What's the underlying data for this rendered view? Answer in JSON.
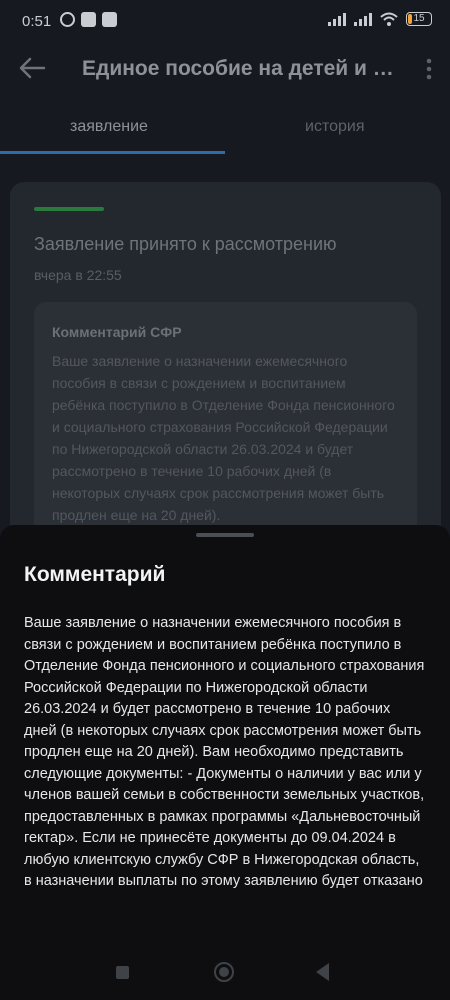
{
  "status_bar": {
    "time": "0:51",
    "battery": "15",
    "battery_color": "#f3a33a"
  },
  "app_bar": {
    "title": "Единое пособие на детей и беременным",
    "back_icon": "arrow-left-icon",
    "more_icon": "more-vertical-icon"
  },
  "tabs": [
    {
      "label": "заявление",
      "active": true
    },
    {
      "label": "история",
      "active": false
    }
  ],
  "card": {
    "status_title": "Заявление принято к рассмотрению",
    "date": "вчера в 22:55",
    "accent_color": "#2b7a3d",
    "comment_header": "Комментарий СФР",
    "comment_preview": "Ваше заявление о назначении ежемесячного пособия в связи с рождением и воспитанием ребёнка поступило в Отделение Фонда пенсионного и социального страхования Российской Федерации по Нижегородской области 26.03.2024 и будет рассмотрено в течение 10 рабочих дней (в некоторых случаях срок рассмотрения может быть продлен еще на 20 дней)."
  },
  "sheet": {
    "title": "Комментарий",
    "body": "Ваше заявление о назначении ежемесячного пособия в связи с рождением и воспитанием ребёнка поступило в Отделение Фонда пенсионного и социального страхования Российской Федерации по Нижегородской области 26.03.2024 и будет рассмотрено в течение 10 рабочих дней (в некоторых случаях срок рассмотрения может быть продлен еще на 20 дней). Вам необходимо представить следующие документы: - Документы о наличии у вас или у членов вашей семьи в собственности земельных участков, предоставленных в рамках программы «Дальневосточный гектар». Если не принесёте документы до 09.04.2024 в любую клиентскую службу СФР в Нижегородская область, в назначении выплаты по этому заявлению будет отказано"
  },
  "tab_accent_color": "#2e6ea8"
}
